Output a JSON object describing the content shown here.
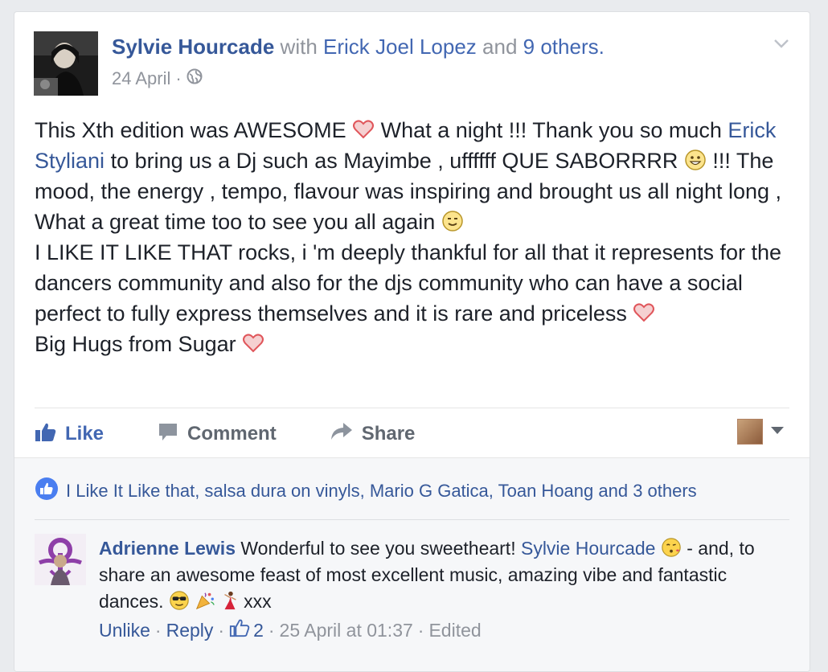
{
  "post": {
    "author": "Sylvie Hourcade",
    "with_word": "with",
    "tagged": "Erick Joel Lopez",
    "and_word": "and",
    "others": "9 others.",
    "date": "24 April",
    "dot": "·",
    "icon_audience": "globe-icon",
    "line1_a": "This Xth edition was AWESOME",
    "line1_b": "What a night !!! Thank you so much",
    "mention": "Erick Styliani",
    "line2_b": "to bring us a Dj such as Mayimbe , uffffff QUE SABORRRR",
    "line3": "!!! The mood, the energy , tempo, flavour was inspiring and brought us all night long ,",
    "line4": "What a great time too to see you all again",
    "line5": "I LIKE IT LIKE THAT rocks, i 'm deeply thankful for all that it represents for the dancers community and also for the djs community who can have a social perfect to fully express themselves and it is rare and priceless",
    "line6": "Big Hugs from Sugar"
  },
  "actions": {
    "like": "Like",
    "comment": "Comment",
    "share": "Share"
  },
  "likes_summary": "I Like It Like that, salsa dura on vinyls, Mario G Gatica, Toan Hoang and 3 others",
  "comment": {
    "author": "Adrienne Lewis",
    "text_a": "Wonderful to see you sweetheart!",
    "mention": "Sylvie Hourcade",
    "text_b": "- and, to share an awesome feast of most excellent music, amazing vibe and fantastic dances.",
    "text_c": "xxx",
    "unlike": "Unlike",
    "reply": "Reply",
    "like_count": "2",
    "timestamp": "25 April at 01:37",
    "edited": "Edited",
    "sep": "·"
  },
  "colors": {
    "link": "#365899",
    "accent": "#4267b2",
    "muted": "#90949c",
    "heart": "#e0565b"
  }
}
